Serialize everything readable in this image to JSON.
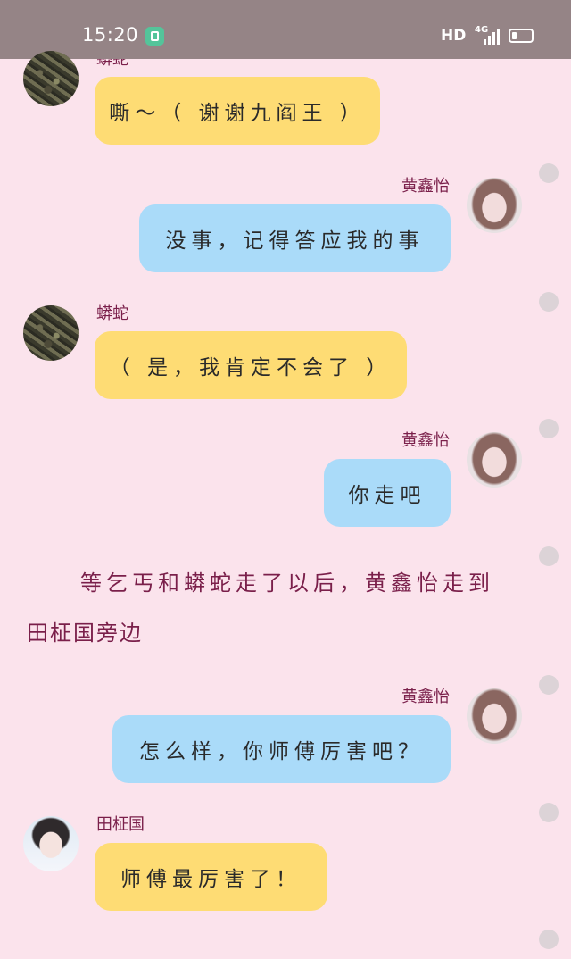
{
  "status_bar": {
    "time": "15:20",
    "hd": "HD",
    "network": "4G"
  },
  "messages": [
    {
      "sender": "蟒蛇",
      "side": "left",
      "text": "嘶～（ 谢谢九阎王 ）"
    },
    {
      "sender": "黄鑫怡",
      "side": "right",
      "text": "没事，记得答应我的事"
    },
    {
      "sender": "蟒蛇",
      "side": "left",
      "text": "（ 是，我肯定不会了 ）"
    },
    {
      "sender": "黄鑫怡",
      "side": "right",
      "text": "你走吧"
    },
    {
      "sender": "黄鑫怡",
      "side": "right",
      "text": "怎么样，你师傅厉害吧？"
    },
    {
      "sender": "田柾国",
      "side": "left",
      "text": "师傅最厉害了！"
    }
  ],
  "narration": {
    "line1": "等乞丐和蟒蛇走了以后，黄鑫怡走到",
    "line2": "田柾国旁边"
  },
  "colors": {
    "background": "#fbe3ec",
    "status_bar": "#958486",
    "bubble_left": "#fedc74",
    "bubble_right": "#aadbf9",
    "name_text": "#7a1f4a"
  }
}
